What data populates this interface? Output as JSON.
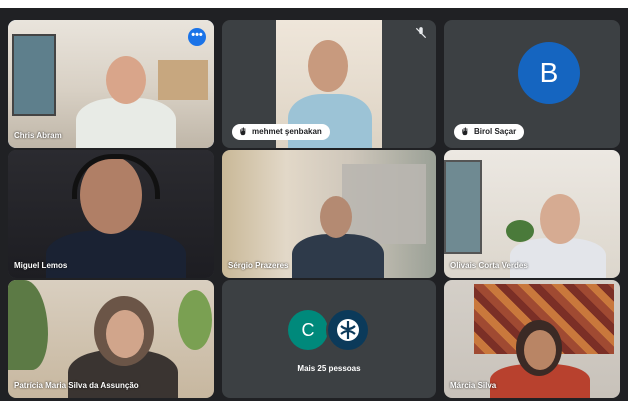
{
  "colors": {
    "stage_bg": "#202124",
    "speaking_border": "#8ab4f8",
    "avatar_birol": "#1565c0",
    "avatar_c": "#00897b",
    "avatar_logo": "#0b3a5a"
  },
  "participants": [
    {
      "name": "Chris Abram",
      "speaking": true,
      "icon": "more-options-icon"
    },
    {
      "name": "mehmet şenbakan",
      "icon": "hand-raise-icon",
      "muted": true
    },
    {
      "name": "Birol Saçar",
      "initial": "B",
      "icon": "hand-raise-icon"
    },
    {
      "name": "Miguel Lemos"
    },
    {
      "name": "Sérgio Prazeres"
    },
    {
      "name": "Olivais Corta Verdes"
    },
    {
      "name": "Patrícia Maria Silva da Assunção"
    },
    {
      "name": "Márcia Silva"
    }
  ],
  "others": {
    "initial": "C",
    "label": "Mais 25 pessoas"
  }
}
